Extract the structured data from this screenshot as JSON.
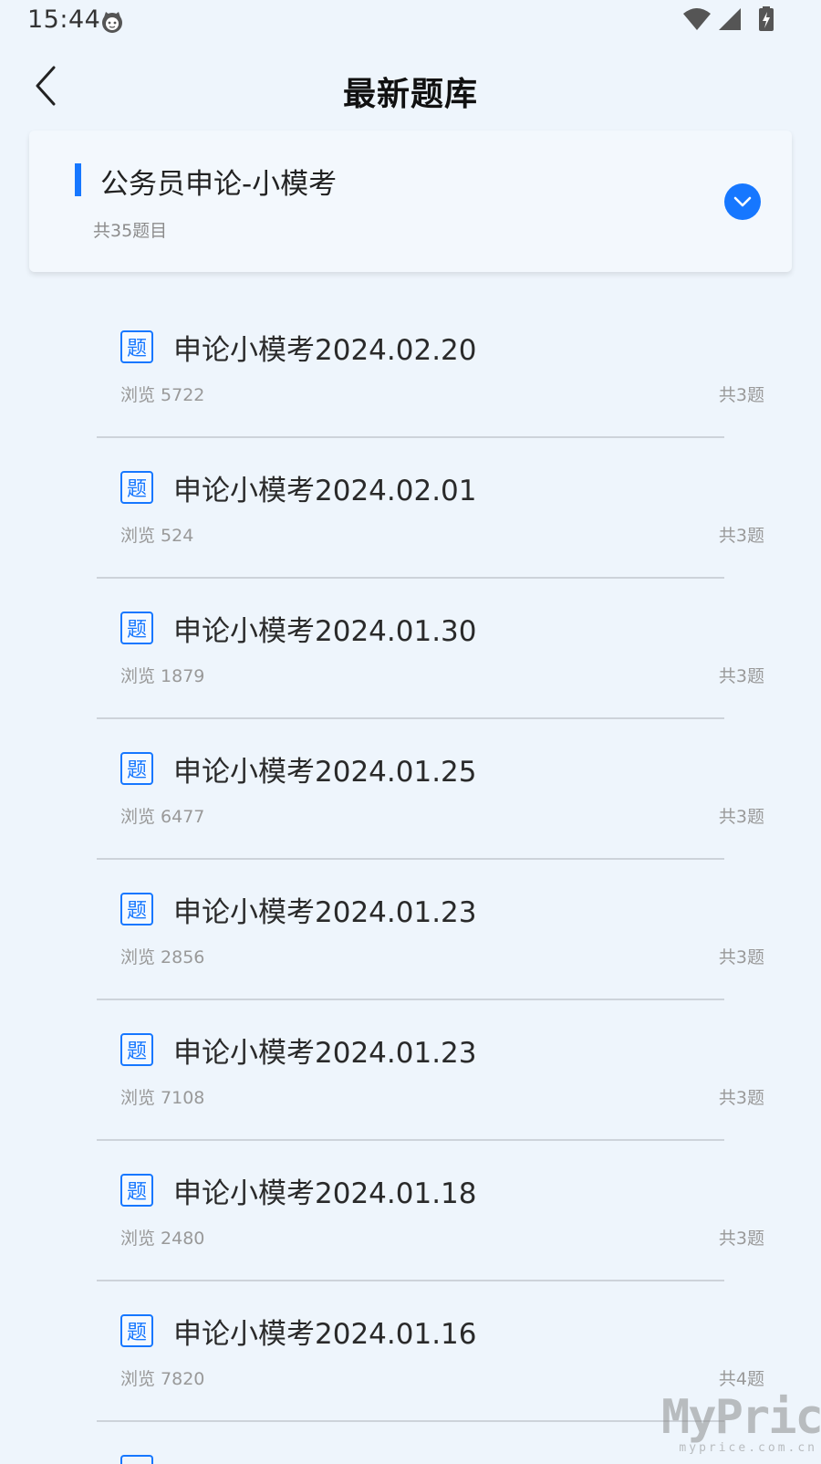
{
  "status": {
    "time": "15:44"
  },
  "header": {
    "title": "最新题库"
  },
  "category": {
    "title": "公务员申论-小模考",
    "count": "共35题目"
  },
  "badge_label": "题",
  "items": [
    {
      "title": "申论小模考2024.02.20",
      "views": "浏览 5722",
      "total": "共3题"
    },
    {
      "title": "申论小模考2024.02.01",
      "views": "浏览 524",
      "total": "共3题"
    },
    {
      "title": "申论小模考2024.01.30",
      "views": "浏览 1879",
      "total": "共3题"
    },
    {
      "title": "申论小模考2024.01.25",
      "views": "浏览 6477",
      "total": "共3题"
    },
    {
      "title": "申论小模考2024.01.23",
      "views": "浏览 2856",
      "total": "共3题"
    },
    {
      "title": "申论小模考2024.01.23",
      "views": "浏览 7108",
      "total": "共3题"
    },
    {
      "title": "申论小模考2024.01.18",
      "views": "浏览 2480",
      "total": "共3题"
    },
    {
      "title": "申论小模考2024.01.16",
      "views": "浏览 7820",
      "total": "共4题"
    }
  ],
  "watermark": {
    "main": "MyPrice",
    "sub": "myprice.com.cn"
  },
  "colors": {
    "accent": "#1677ff",
    "background": "#eef5fc"
  },
  "icons": [
    "back-arrow-icon",
    "chevron-down-icon",
    "wifi-icon",
    "signal-icon",
    "battery-charging-icon",
    "notification-cat-icon"
  ]
}
